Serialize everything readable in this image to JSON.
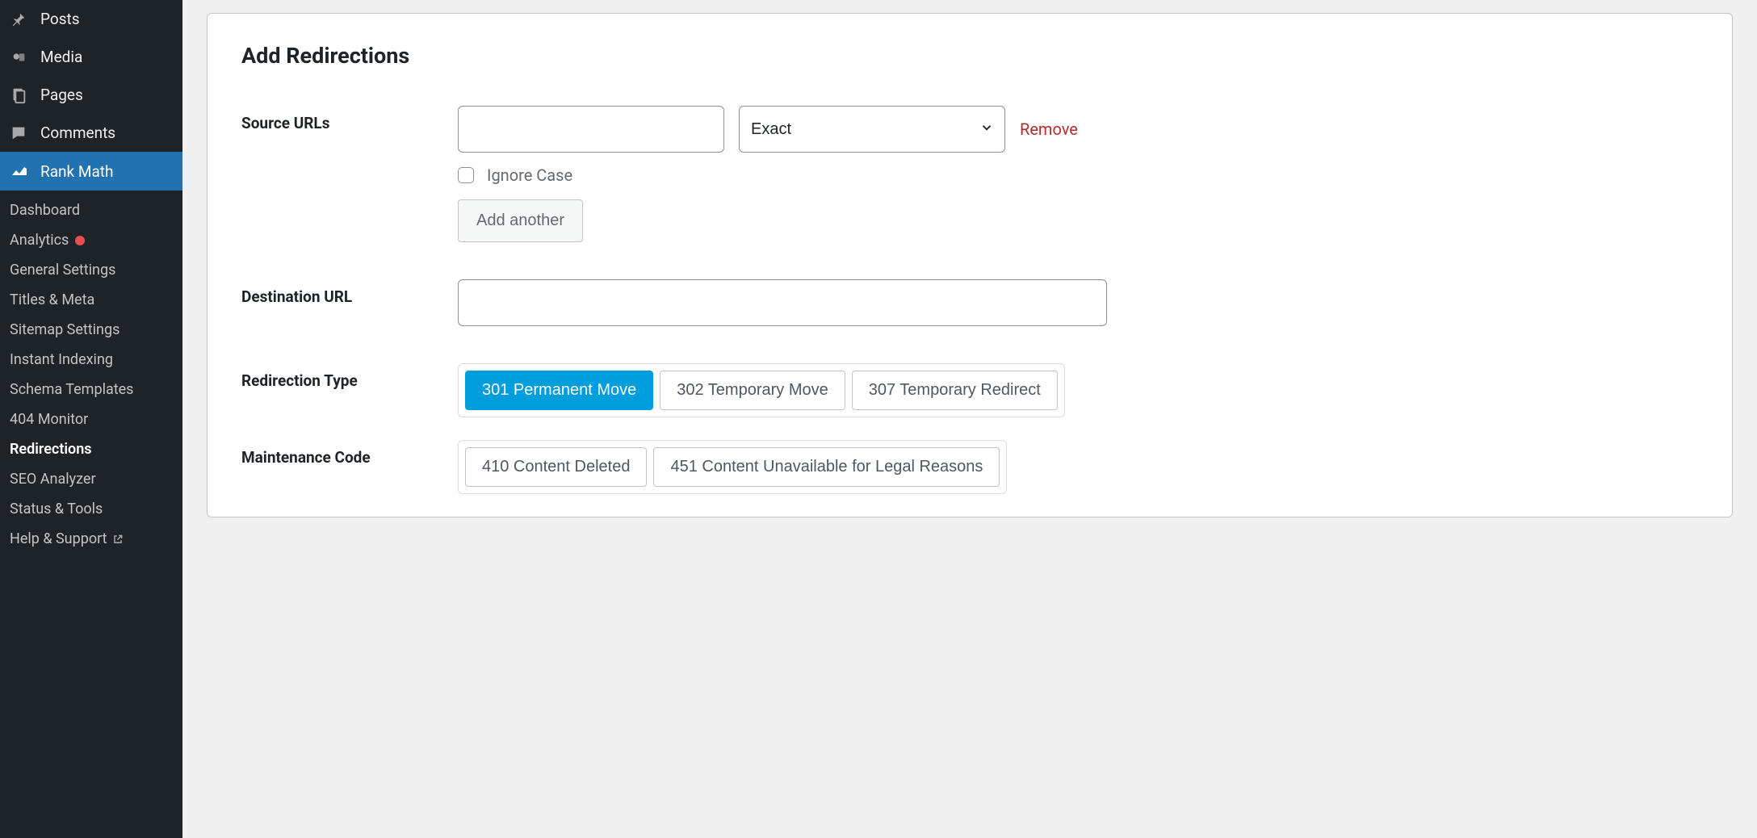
{
  "sidebar": {
    "top_items": [
      {
        "name": "posts",
        "label": "Posts"
      },
      {
        "name": "media",
        "label": "Media"
      },
      {
        "name": "pages",
        "label": "Pages"
      },
      {
        "name": "comments",
        "label": "Comments"
      },
      {
        "name": "rank-math",
        "label": "Rank Math",
        "active": true
      }
    ],
    "sub_items": [
      {
        "name": "dashboard",
        "label": "Dashboard"
      },
      {
        "name": "analytics",
        "label": "Analytics",
        "has_dot": true
      },
      {
        "name": "general-settings",
        "label": "General Settings"
      },
      {
        "name": "titles-meta",
        "label": "Titles & Meta"
      },
      {
        "name": "sitemap-settings",
        "label": "Sitemap Settings"
      },
      {
        "name": "instant-indexing",
        "label": "Instant Indexing"
      },
      {
        "name": "schema-templates",
        "label": "Schema Templates"
      },
      {
        "name": "404-monitor",
        "label": "404 Monitor"
      },
      {
        "name": "redirections",
        "label": "Redirections",
        "current": true
      },
      {
        "name": "seo-analyzer",
        "label": "SEO Analyzer"
      },
      {
        "name": "status-tools",
        "label": "Status & Tools"
      },
      {
        "name": "help-support",
        "label": "Help & Support",
        "external": true
      }
    ]
  },
  "panel": {
    "title": "Add Redirections",
    "source_label": "Source URLs",
    "source_value": "",
    "match_type_selected": "Exact",
    "remove_label": "Remove",
    "ignore_case_label": "Ignore Case",
    "add_another_label": "Add another",
    "destination_label": "Destination URL",
    "destination_value": "",
    "redirection_type_label": "Redirection Type",
    "redirection_types": [
      {
        "label": "301 Permanent Move",
        "active": true
      },
      {
        "label": "302 Temporary Move",
        "active": false
      },
      {
        "label": "307 Temporary Redirect",
        "active": false
      }
    ],
    "maintenance_code_label": "Maintenance Code",
    "maintenance_codes": [
      {
        "label": "410 Content Deleted"
      },
      {
        "label": "451 Content Unavailable for Legal Reasons"
      }
    ]
  }
}
